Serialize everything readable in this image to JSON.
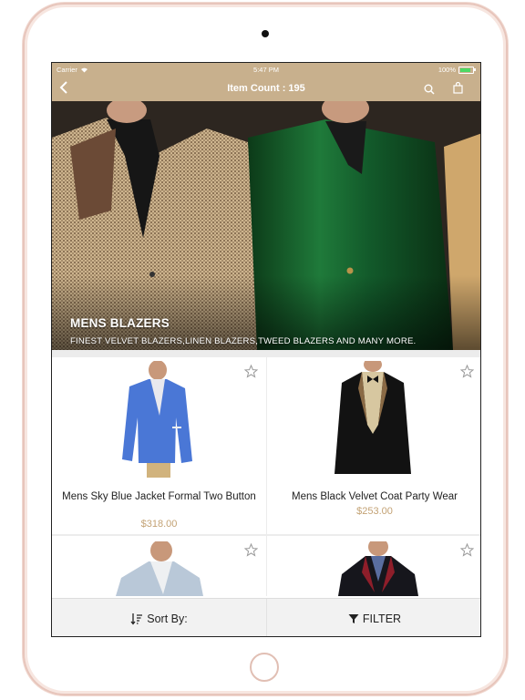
{
  "status_bar": {
    "carrier": "Carrier",
    "time": "5:47 PM",
    "battery": "100%"
  },
  "nav": {
    "title": "Item Count : 195"
  },
  "banner": {
    "title": "MENS BLAZERS",
    "subtitle": "FINEST VELVET BLAZERS,LINEN BLAZERS,TWEED BLAZERS AND MANY MORE."
  },
  "products": [
    {
      "name": "Mens Sky Blue Jacket Formal Two Button",
      "price": "$318.00"
    },
    {
      "name": "Mens Black Velvet Coat Party Wear",
      "price": "$253.00"
    },
    {
      "name": "",
      "price": ""
    },
    {
      "name": "",
      "price": ""
    }
  ],
  "bottom_bar": {
    "sort_label": "Sort By:",
    "filter_label": "FILTER"
  },
  "colors": {
    "accent": "#c8b08d",
    "price": "#c3a274"
  }
}
